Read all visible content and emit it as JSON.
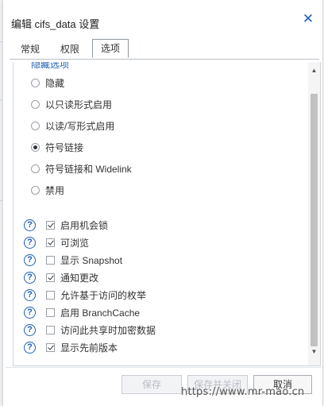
{
  "dialog": {
    "title": "编辑 cifs_data 设置",
    "close_icon": "close-icon"
  },
  "tabs": [
    {
      "label": "常规",
      "active": false
    },
    {
      "label": "权限",
      "active": false
    },
    {
      "label": "选项",
      "active": true
    }
  ],
  "visibility": {
    "section_label_partial": "隐藏选项",
    "options": [
      {
        "label": "隐藏",
        "selected": false
      },
      {
        "label": "以只读形式启用",
        "selected": false
      },
      {
        "label": "以读/写形式启用",
        "selected": false
      },
      {
        "label": "符号链接",
        "selected": true
      },
      {
        "label": "符号链接和 Widelink",
        "selected": false
      },
      {
        "label": "禁用",
        "selected": false
      }
    ]
  },
  "settings": [
    {
      "label": "启用机会锁",
      "checked": true
    },
    {
      "label": "可浏览",
      "checked": true
    },
    {
      "label": "显示 Snapshot",
      "checked": false
    },
    {
      "label": "通知更改",
      "checked": true
    },
    {
      "label": "允许基于访问的枚举",
      "checked": false
    },
    {
      "label": "启用 BranchCache",
      "checked": false
    },
    {
      "label": "访问此共享时加密数据",
      "checked": false
    },
    {
      "label": "显示先前版本",
      "checked": true
    }
  ],
  "help_icon_glyph": "?",
  "footer": {
    "save_label": "保存",
    "save_close_label": "保存并关闭",
    "cancel_label": "取消"
  },
  "watermark": "https://www.mr-mao.cn",
  "colors": {
    "accent": "#1f5fb8"
  }
}
